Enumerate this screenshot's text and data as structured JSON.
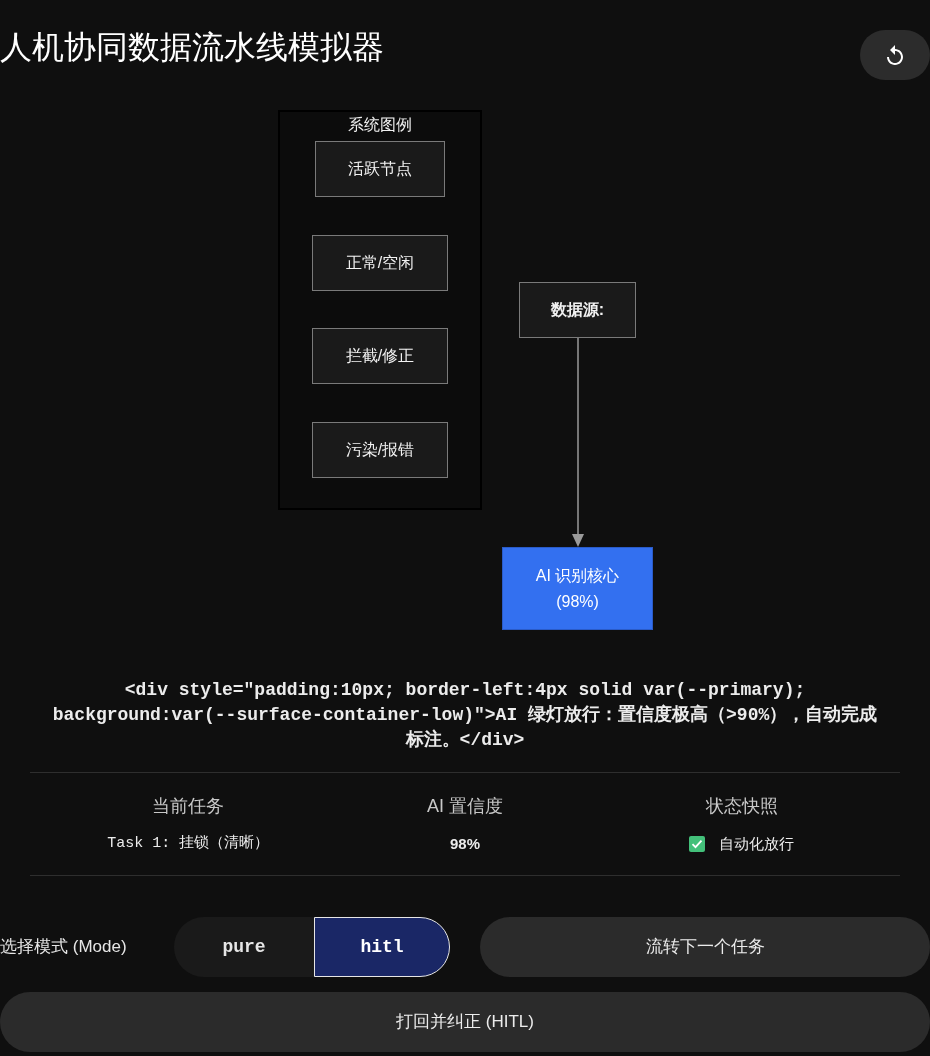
{
  "title": "人机协同数据流水线模拟器",
  "diagram": {
    "legend": {
      "title": "系统图例",
      "items": [
        "活跃节点",
        "正常/空闲",
        "拦截/修正",
        "污染/报错"
      ]
    },
    "nodes": [
      {
        "label": "数据源:",
        "active": false
      },
      {
        "label": "AI 识别核心",
        "reading": "(98%)",
        "active": true
      }
    ]
  },
  "message": "<div style=\"padding:10px; border-left:4px solid var(--primary); background:var(--surface-container-low)\">AI 绿灯放行：置信度极高（>90%），自动完成标注。</div>",
  "stats": [
    {
      "label": "当前任务",
      "value": "Task 1: 挂锁（清晰）",
      "kind": "code"
    },
    {
      "label": "AI 置信度",
      "value": "98%",
      "kind": "text"
    },
    {
      "label": "状态快照",
      "value": "自动化放行",
      "kind": "check",
      "checked": true
    }
  ],
  "mode": {
    "label": "选择模式 (Mode)",
    "options": [
      {
        "label": "pure",
        "selected": false
      },
      {
        "label": "hitl",
        "selected": true
      }
    ]
  },
  "actions": [
    "流转下一个任务",
    "打回并纠正 (HITL)"
  ]
}
